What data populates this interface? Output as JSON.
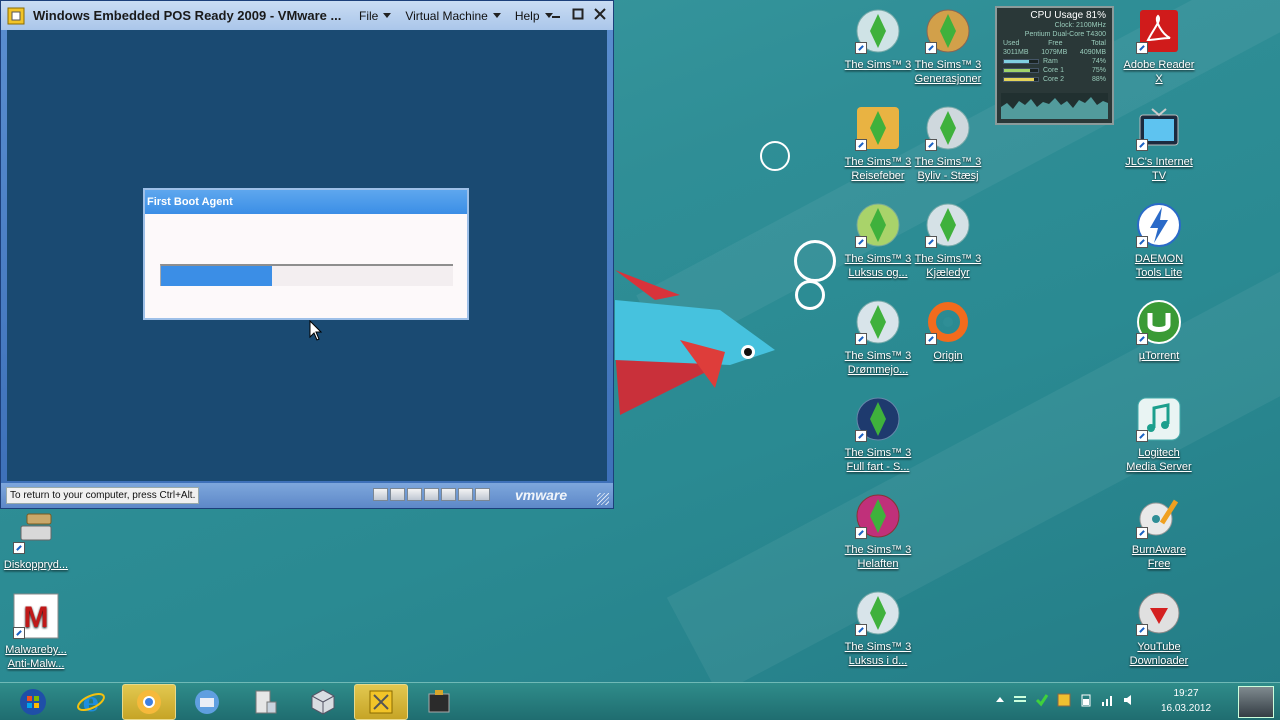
{
  "vmware": {
    "title": "Windows Embedded POS Ready 2009 - VMware ...",
    "menu": {
      "file": "File",
      "virtual_machine": "Virtual Machine",
      "help": "Help"
    },
    "status_hint": "To return to your computer, press Ctrl+Alt.",
    "logo": "vmware"
  },
  "first_boot_agent": {
    "title": "First Boot Agent",
    "progress_percent": 38
  },
  "cpu_gadget": {
    "title": "CPU Usage",
    "cpu_percent": "81%",
    "clock": "Clock: 2100MHz",
    "processor": "Pentium Dual-Core T4300",
    "mem_headers": [
      "Used",
      "Free",
      "Total"
    ],
    "mem_values": [
      "3011MB",
      "1079MB",
      "4090MB"
    ],
    "ram_label": "Ram",
    "ram_percent": "74%",
    "core1_label": "Core 1",
    "core1_percent": "75%",
    "core2_label": "Core 2",
    "core2_percent": "88%"
  },
  "desktop_icons": {
    "diskopprydding": "Diskoppryd...",
    "malwarebytes": "Malwareby... Anti-Malw...",
    "sims3": "The Sims™ 3",
    "sims3_gen": "The Sims™ 3 Generasjoner",
    "sims3_reise": "The Sims™ 3 Reisefeber",
    "sims3_byliv": "The Sims™ 3 Byliv - Stæsj",
    "sims3_luksus_og": "The Sims™ 3 Luksus og...",
    "sims3_kjaeledyr": "The Sims™ 3 Kjæledyr",
    "sims3_drommejo": "The Sims™ 3 Drømmejo...",
    "origin": "Origin",
    "sims3_full_fart": "The Sims™ 3 Full fart - S...",
    "sims3_helaften": "The Sims™ 3 Helaften",
    "sims3_luksus_id": "The Sims™ 3 Luksus i d...",
    "adobe": "Adobe Reader X",
    "jlc": "JLC's Internet TV",
    "daemon": "DAEMON Tools Lite",
    "utorrent": "µTorrent",
    "logitech": "Logitech Media Server",
    "burnaware": "BurnAware Free",
    "youtube": "YouTube Downloader"
  },
  "taskbar": {
    "time": "19:27",
    "date": "16.03.2012"
  },
  "colors": {
    "desktop": "#2f8e96",
    "guest": "#1a4a72",
    "progress": "#3b8ee6"
  }
}
